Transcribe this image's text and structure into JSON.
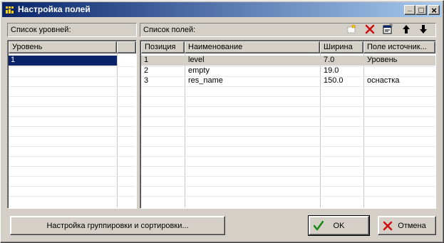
{
  "window": {
    "title": "Настройка полей",
    "controls": {
      "minimize": "_",
      "maximize": "□",
      "close": "×"
    }
  },
  "left_panel": {
    "header": "Список уровней:",
    "columns": [
      "Уровень"
    ],
    "rows": [
      {
        "level": "1",
        "selected": true
      }
    ]
  },
  "right_panel": {
    "header": "Список полей:",
    "toolbar": {
      "icons": [
        "new-icon",
        "delete-icon",
        "properties-icon",
        "arrow-up-icon",
        "arrow-down-icon"
      ]
    },
    "columns": [
      "Позиция",
      "Наименование",
      "Ширина",
      "Поле источник..."
    ],
    "rows": [
      {
        "pos": "1",
        "name": "level",
        "width": "7.0",
        "source": "Уровень"
      },
      {
        "pos": "2",
        "name": "empty",
        "width": "19.0",
        "source": ""
      },
      {
        "pos": "3",
        "name": "res_name",
        "width": "150.0",
        "source": "оснастка"
      }
    ]
  },
  "buttons": {
    "grouping": "Настройка группировки и сортировки...",
    "ok": "OK",
    "cancel": "Отмена"
  },
  "colors": {
    "title_start": "#0a246a",
    "title_end": "#a6caf0",
    "selection": "#0a246a",
    "ok_check": "#1a8a1a",
    "delete": "#d01010"
  }
}
